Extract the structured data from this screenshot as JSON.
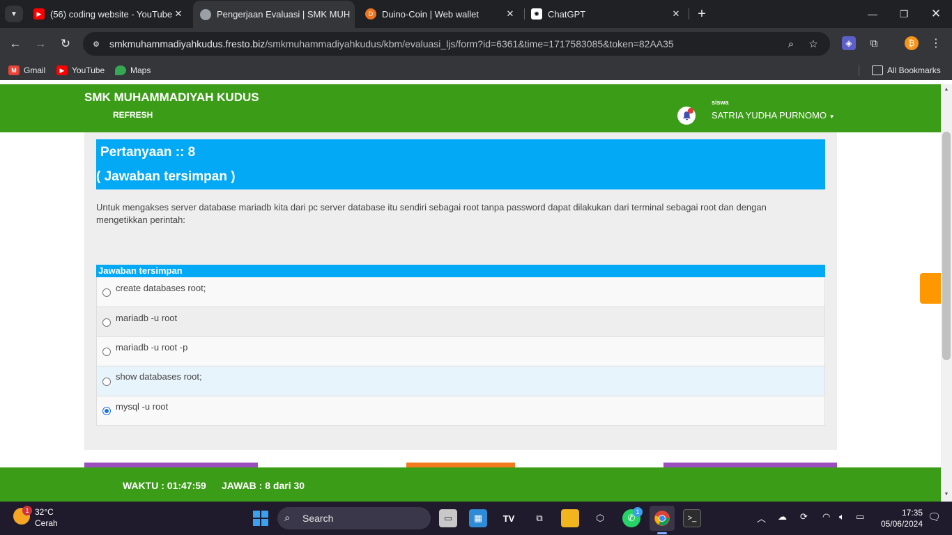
{
  "browser": {
    "tabs": [
      {
        "title": "(56) coding website - YouTube",
        "icon": "youtube-icon"
      },
      {
        "title": "Pengerjaan Evaluasi | SMK MUH",
        "icon": "globe-icon"
      },
      {
        "title": "Duino-Coin | Web wallet",
        "icon": "duinocoin-icon"
      },
      {
        "title": "ChatGPT",
        "icon": "chatgpt-icon"
      }
    ],
    "url_host": "smkmuhammadiyahkudus.fresto.biz",
    "url_path": "/smkmuhammadiyahkudus/kbm/evaluasi_ljs/form?id=6361&time=1717583085&token=82AA35",
    "bookmarks": [
      "Gmail",
      "YouTube",
      "Maps"
    ],
    "all_bookmarks": "All Bookmarks"
  },
  "site": {
    "brand": "SMK MUHAMMADIYAH KUDUS",
    "refresh": "REFRESH",
    "role": "siswa",
    "user": "SATRIA YUDHA PURNOMO",
    "notification_count": "1",
    "green": "#3b9c17",
    "blue": "#03a9f4"
  },
  "question": {
    "number_label": "Pertanyaan :: 8",
    "status": "( Jawaban tersimpan )",
    "text": "Untuk mengakses server database mariadb kita dari pc server database itu sendiri sebagai root tanpa password dapat dilakukan dari terminal sebagai root dan dengan mengetikkan perintah:",
    "answers_header": "Jawaban tersimpan",
    "options": [
      {
        "label": "create databases root;",
        "selected": false
      },
      {
        "label": "mariadb -u root",
        "selected": false
      },
      {
        "label": "mariadb -u root -p",
        "selected": false
      },
      {
        "label": "show databases root;",
        "selected": false
      },
      {
        "label": "mysql -u root",
        "selected": true
      }
    ]
  },
  "footer": {
    "waktu": "WAKTU : 01:47:59",
    "jawab": "JAWAB : 8 dari 30"
  },
  "taskbar": {
    "temperature": "32°C",
    "condition": "Cerah",
    "weather_badge": "1",
    "search": "Search",
    "whatsapp_badge": "1",
    "time": "17:35",
    "date": "05/06/2024"
  }
}
